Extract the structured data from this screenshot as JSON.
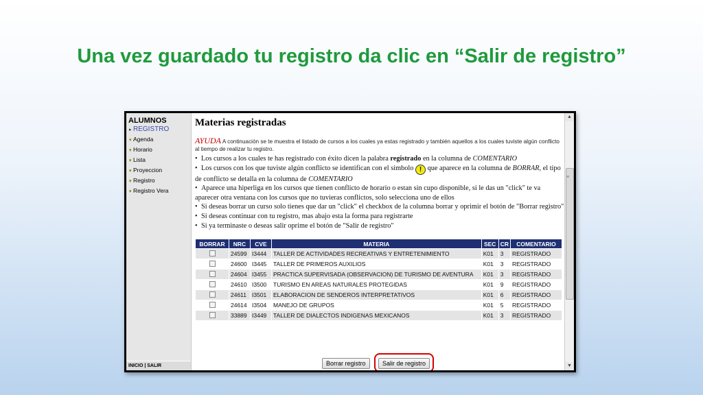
{
  "slide": {
    "title": "Una vez guardado tu registro da clic en “Salir de registro”"
  },
  "sidebar": {
    "title": "ALUMNOS",
    "items": [
      {
        "label": "REGISTRO",
        "icon": "arrow-right-icon"
      },
      {
        "label": "Agenda",
        "icon": "folder-icon"
      },
      {
        "label": "Horario",
        "icon": "folder-icon"
      },
      {
        "label": "Lista",
        "icon": "folder-icon"
      },
      {
        "label": "Proyeccion",
        "icon": "folder-icon"
      },
      {
        "label": "Registro",
        "icon": "folder-icon"
      },
      {
        "label": "Registro Vera",
        "icon": "folder-icon"
      }
    ],
    "footer": "INICIO | SALIR"
  },
  "main": {
    "title": "Materias registradas",
    "ayuda": "AYUDA",
    "intro": "A continuación se te muestra el listado de cursos a los cuales ya estas registrado y también aquellos a los cuales tuviste algún conflicto al tiempo de realizar tu registro.",
    "bullets": {
      "b1_pre": "Los cursos a los cuales te has registrado con éxito dicen la palabra",
      "b1_bold": "registrado",
      "b1_mid": "en la columna de",
      "b1_ital": "COMENTARIO",
      "b2_pre": "Los cursos con los que tuviste algún conflicto se identifican con el simbolo",
      "b2_mid": "que aparece en la columna de",
      "b2_ital1": "BORRAR",
      "b2_post": ", el tipo de conflicto se detalla en la columna de",
      "b2_ital2": "COMENTARIO",
      "b3": "Aparece una hiperliga en los cursos que tienen conflicto de horario o estan sin cupo disponible, si le das un \"click\" te va aparecer otra ventana con los cursos que no tuvieras conflictos, solo selecciona uno de ellos",
      "b4": "Si deseas borrar un curso solo tienes que dar un \"click\" el checkbox de la columna borrar y oprimir el botón de \"Borrar registro\"",
      "b5": "Si deseas continuar con tu registro, mas abajo esta la forma para registrarte",
      "b6": "Si ya terminaste o deseas salir oprime el botón de \"Salir de registro\""
    },
    "warn_symbol": "!",
    "table": {
      "headers": [
        "BORRAR",
        "NRC",
        "CVE",
        "MATERIA",
        "SEC",
        "CR",
        "COMENTARIO"
      ],
      "rows": [
        {
          "nrc": "24599",
          "cve": "I3444",
          "materia": "TALLER DE ACTIVIDADES RECREATIVAS Y ENTRETENIMIENTO",
          "sec": "K01",
          "cr": "3",
          "comentario": "REGISTRADO"
        },
        {
          "nrc": "24600",
          "cve": "I3445",
          "materia": "TALLER DE PRIMEROS AUXILIOS",
          "sec": "K01",
          "cr": "3",
          "comentario": "REGISTRADO"
        },
        {
          "nrc": "24604",
          "cve": "I3455",
          "materia": "PRACTICA SUPERVISADA (OBSERVACION) DE TURISMO DE AVENTURA",
          "sec": "K01",
          "cr": "3",
          "comentario": "REGISTRADO"
        },
        {
          "nrc": "24610",
          "cve": "I3500",
          "materia": "TURISMO EN AREAS NATURALES PROTEGIDAS",
          "sec": "K01",
          "cr": "9",
          "comentario": "REGISTRADO"
        },
        {
          "nrc": "24611",
          "cve": "I3501",
          "materia": "ELABORACION DE SENDEROS INTERPRETATIVOS",
          "sec": "K01",
          "cr": "6",
          "comentario": "REGISTRADO"
        },
        {
          "nrc": "24614",
          "cve": "I3504",
          "materia": "MANEJO DE GRUPOS",
          "sec": "K01",
          "cr": "5",
          "comentario": "REGISTRADO"
        },
        {
          "nrc": "33889",
          "cve": "I3449",
          "materia": "TALLER DE DIALECTOS INDIGENAS MEXICANOS",
          "sec": "K01",
          "cr": "3",
          "comentario": "REGISTRADO"
        }
      ]
    },
    "buttons": {
      "borrar": "Borrar registro",
      "salir": "Salir de registro"
    }
  },
  "colors": {
    "title_green": "#1f9a3c",
    "table_header": "#1e2f73",
    "highlight_red": "#d40000",
    "ayuda_red": "#c00000"
  }
}
